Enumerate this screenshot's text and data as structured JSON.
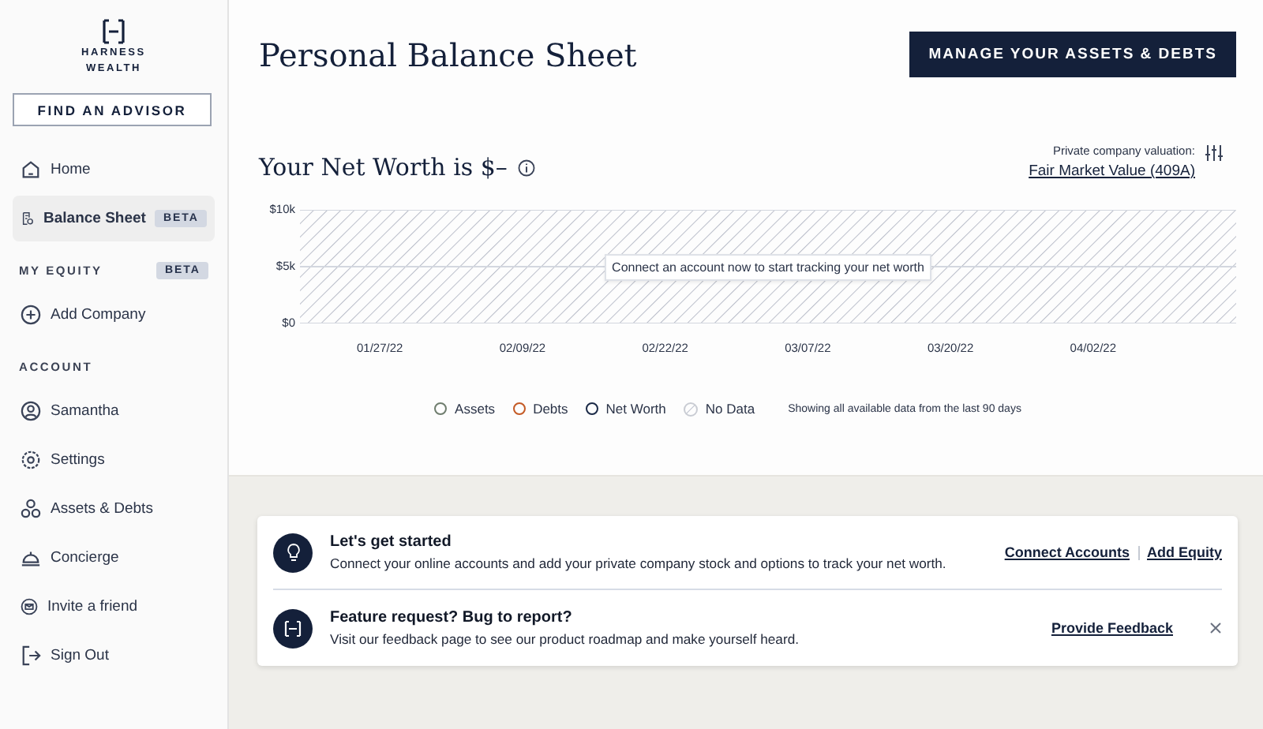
{
  "sidebar": {
    "logo": {
      "line_1": "HARNESS",
      "line_2": "WEALTH"
    },
    "advisor_button": "FIND AN ADVISOR",
    "items": [
      {
        "kind": "link",
        "label": "Home",
        "selected": false
      },
      {
        "kind": "link",
        "label": "Balance Sheet",
        "selected": true,
        "badge": "BETA"
      },
      {
        "kind": "section",
        "label": "MY EQUITY",
        "badge": "BETA"
      },
      {
        "kind": "link",
        "label": "Add Company",
        "selected": false
      },
      {
        "kind": "section",
        "label": "ACCOUNT"
      },
      {
        "kind": "link",
        "label": "Samantha",
        "selected": false
      },
      {
        "kind": "link",
        "label": "Settings",
        "selected": false
      },
      {
        "kind": "link",
        "label": "Assets & Debts",
        "selected": false
      },
      {
        "kind": "link",
        "label": "Concierge",
        "selected": false
      },
      {
        "kind": "link",
        "label": "Invite a friend",
        "selected": false
      },
      {
        "kind": "link",
        "label": "Sign Out",
        "selected": false
      }
    ]
  },
  "header": {
    "title": "Personal Balance Sheet",
    "button": "MANAGE YOUR ASSETS & DEBTS"
  },
  "net_worth": {
    "heading": "Your Net Worth is $–",
    "valuation_label": "Private company valuation:",
    "valuation_link": "Fair Market Value (409A)"
  },
  "chart": {
    "empty_message": "Connect an account now to start tracking your net worth",
    "chart_data": {
      "type": "line",
      "categories": [
        "01/27/22",
        "02/09/22",
        "02/22/22",
        "03/07/22",
        "03/20/22",
        "04/02/22"
      ],
      "ylim": [
        0,
        10000
      ],
      "yticks": [
        {
          "value": 0,
          "label": "$0"
        },
        {
          "value": 5000,
          "label": "$5k"
        },
        {
          "value": 10000,
          "label": "$10k"
        }
      ]
    },
    "legend": [
      {
        "kind": "ring",
        "label": "Assets",
        "color": "#6f7d6e"
      },
      {
        "kind": "ring",
        "label": "Debts",
        "color": "#c45a25"
      },
      {
        "kind": "ring",
        "label": "Net Worth",
        "color": "#1b2a47"
      },
      {
        "kind": "hatch",
        "label": "No Data",
        "color": "#c9ccd3"
      }
    ],
    "range_note": "Showing all available data from the last 90 days"
  },
  "notices": [
    {
      "kind": "bulb",
      "title": "Let's get started",
      "text": "Connect your online accounts and add your private company stock and options to track your net worth.",
      "links": [
        "Connect Accounts",
        "Add Equity"
      ]
    },
    {
      "kind": "logo",
      "title": "Feature request? Bug to report?",
      "text": "Visit our feedback page to see our product roadmap and make yourself heard.",
      "links": [
        "Provide Feedback"
      ],
      "closable": true
    }
  ]
}
